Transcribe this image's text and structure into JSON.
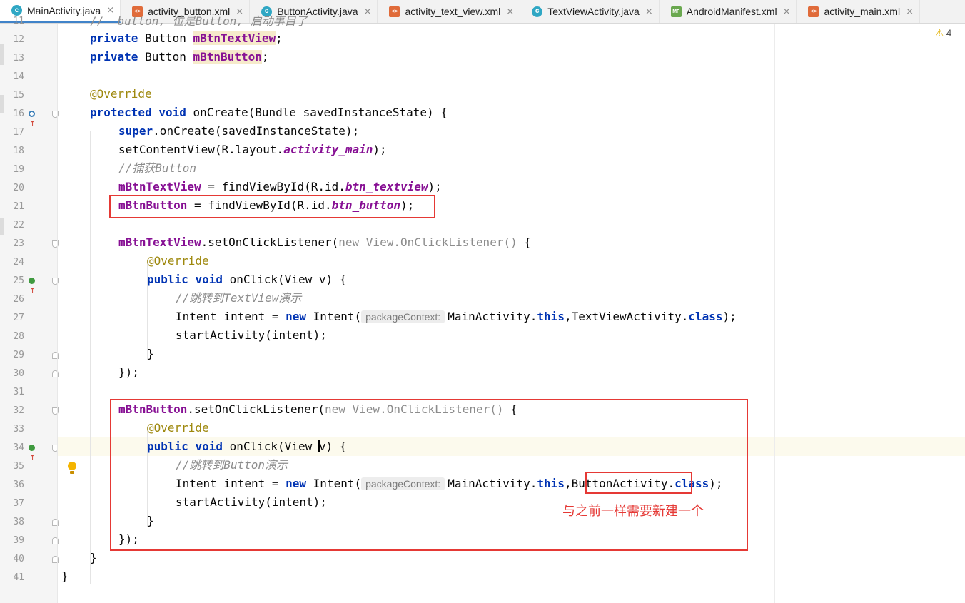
{
  "tabs": [
    {
      "label": "MainActivity.java",
      "icon": "java-class-icon",
      "type": "java",
      "active": true
    },
    {
      "label": "activity_button.xml",
      "icon": "xml-file-icon",
      "type": "xml",
      "active": false
    },
    {
      "label": "ButtonActivity.java",
      "icon": "java-class-icon",
      "type": "java",
      "active": false
    },
    {
      "label": "activity_text_view.xml",
      "icon": "xml-file-icon",
      "type": "xml",
      "active": false
    },
    {
      "label": "TextViewActivity.java",
      "icon": "java-class-icon",
      "type": "java",
      "active": false
    },
    {
      "label": "AndroidManifest.xml",
      "icon": "manifest-file-icon",
      "type": "mf",
      "active": false
    },
    {
      "label": "activity_main.xml",
      "icon": "xml-file-icon",
      "type": "xml",
      "active": false
    }
  ],
  "tab_close_glyph": "×",
  "warnings": {
    "count": "4",
    "icon": "warning-triangle-icon"
  },
  "gutter": {
    "line_numbers": [
      "11",
      "12",
      "13",
      "14",
      "15",
      "16",
      "17",
      "18",
      "19",
      "20",
      "21",
      "22",
      "23",
      "24",
      "25",
      "26",
      "27",
      "28",
      "29",
      "30",
      "31",
      "32",
      "33",
      "34",
      "35",
      "36",
      "37",
      "38",
      "39",
      "40",
      "41"
    ],
    "markers": [
      {
        "line": "16",
        "icon": "override-method-icon",
        "kind": "blue"
      },
      {
        "line": "25",
        "icon": "implement-method-icon",
        "kind": "green"
      },
      {
        "line": "34",
        "icon": "implement-method-icon",
        "kind": "green"
      }
    ]
  },
  "code": {
    "l11_partial": "//  button, 位是Button, 启动事目了",
    "l12_kw": "private",
    "l12_type": "Button",
    "l12_field": "mBtnTextView",
    "l13_kw": "private",
    "l13_type": "Button",
    "l13_field": "mBtnButton",
    "l15": "@Override",
    "l16_kw1": "protected",
    "l16_kw2": "void",
    "l16_rest": "onCreate(Bundle savedInstanceState) {",
    "l17_kw": "super",
    "l17_rest": ".onCreate(savedInstanceState);",
    "l18_a": "setContentView(R.layout.",
    "l18_f": "activity_main",
    "l18_b": ");",
    "l19": "//捕获Button",
    "l20_f": "mBtnTextView",
    "l20_a": " = findViewById(R.id.",
    "l20_s": "btn_textview",
    "l20_b": ");",
    "l21_f": "mBtnButton",
    "l21_a": " = findViewById(R.id.",
    "l21_s": "btn_button",
    "l21_b": ");",
    "l23_f": "mBtnTextView",
    "l23_a": ".setOnClickListener(",
    "l23_kw": "new",
    "l23_dim": "View.OnClickListener()",
    "l23_b": " {",
    "l24": "@Override",
    "l25_kw1": "public",
    "l25_kw2": "void",
    "l25_rest": "onClick(View v) {",
    "l26": "//跳转到TextView演示",
    "l27_a": "Intent intent = ",
    "l27_kw": "new",
    "l27_b": "Intent(",
    "l27_hint": "packageContext:",
    "l27_c": "MainActivity.",
    "l27_kw2": "this",
    "l27_d": ",TextViewActivity.",
    "l27_kw3": "class",
    "l27_e": ");",
    "l28": "startActivity(intent);",
    "l29": "}",
    "l30": "});",
    "l32_f": "mBtnButton",
    "l32_a": ".setOnClickListener(",
    "l32_kw": "new",
    "l32_dim": "View.OnClickListener()",
    "l32_b": " {",
    "l33": "@Override",
    "l34_kw1": "public",
    "l34_kw2": "void",
    "l34_a": "onClick(View ",
    "l34_b": "v) {",
    "l35": "//跳转到Button演示",
    "l36_a": "Intent intent = ",
    "l36_kw": "new",
    "l36_b": "Intent(",
    "l36_hint": "packageContext:",
    "l36_c": "MainActivity.",
    "l36_kw2": "this",
    "l36_d": ",",
    "l36_e": "ButtonActivity",
    "l36_g": ".",
    "l36_kw3": "class",
    "l36_h": ");",
    "l37": "startActivity(intent);",
    "l38": "}",
    "l39": "});",
    "l40": "}",
    "l41": "}"
  },
  "annotation_text": "与之前一样需要新建一个",
  "colors": {
    "keyword": "#0033b3",
    "annotation": "#9e880d",
    "field": "#871094",
    "comment": "#8c8c8c",
    "highlight_box": "#e53935",
    "caret_line": "#fcfaed"
  }
}
